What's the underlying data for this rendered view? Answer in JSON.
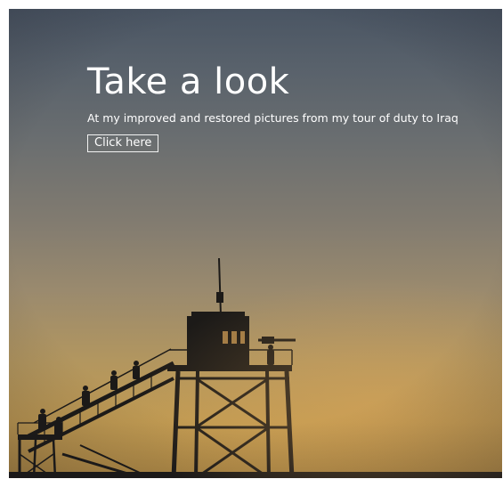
{
  "hero": {
    "title": "Take a look",
    "subtitle": "At my improved and restored pictures from my tour of duty to Iraq",
    "button_label": "Click here"
  },
  "colors": {
    "sky_top": "#4a5563",
    "sky_bottom": "#c09a52",
    "silhouette": "#1c1a18",
    "text": "#ffffff"
  }
}
